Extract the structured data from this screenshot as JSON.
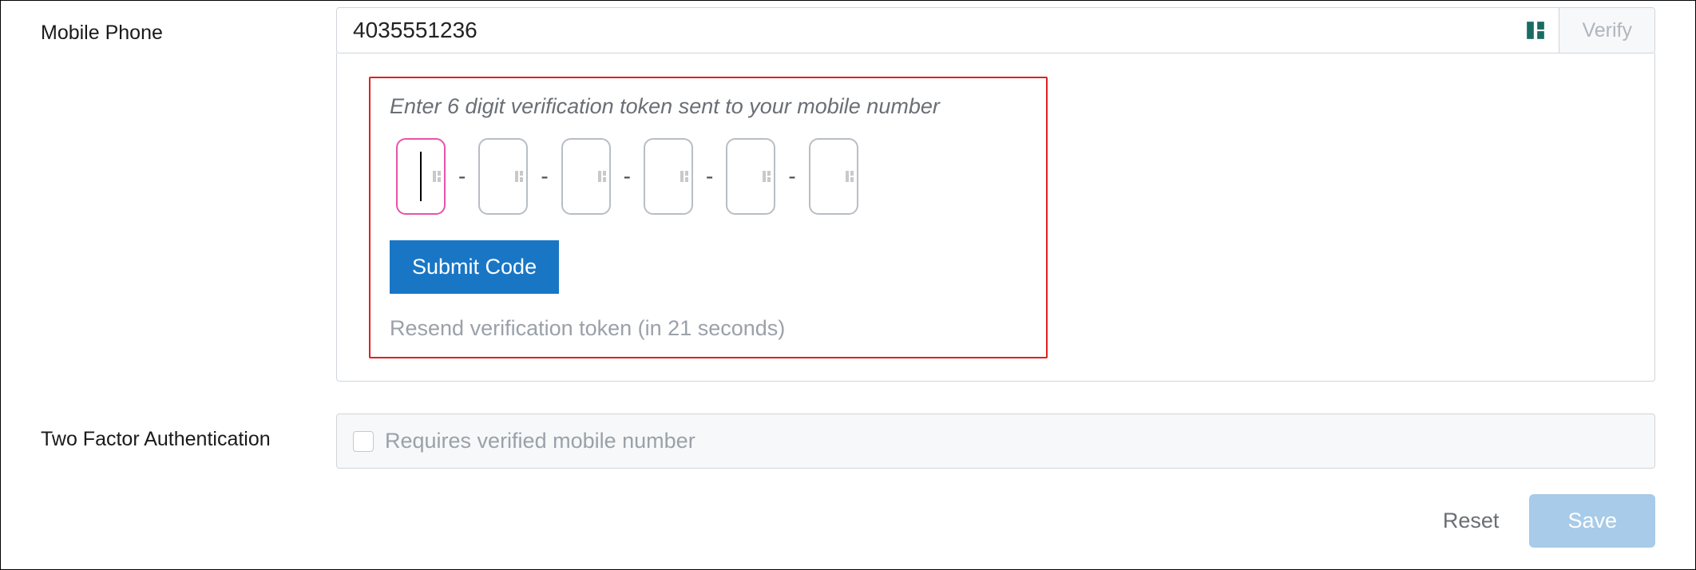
{
  "mobile_phone": {
    "label": "Mobile Phone",
    "value": "4035551236",
    "verify_label": "Verify"
  },
  "verification": {
    "instruction": "Enter 6 digit verification token sent to your mobile number",
    "digit_count": 6,
    "submit_label": "Submit Code",
    "resend_text": "Resend verification token (in 21 seconds)",
    "separator": "-"
  },
  "two_factor": {
    "label": "Two Factor Authentication",
    "checkbox_label": "Requires verified mobile number",
    "checked": false
  },
  "actions": {
    "reset_label": "Reset",
    "save_label": "Save"
  }
}
